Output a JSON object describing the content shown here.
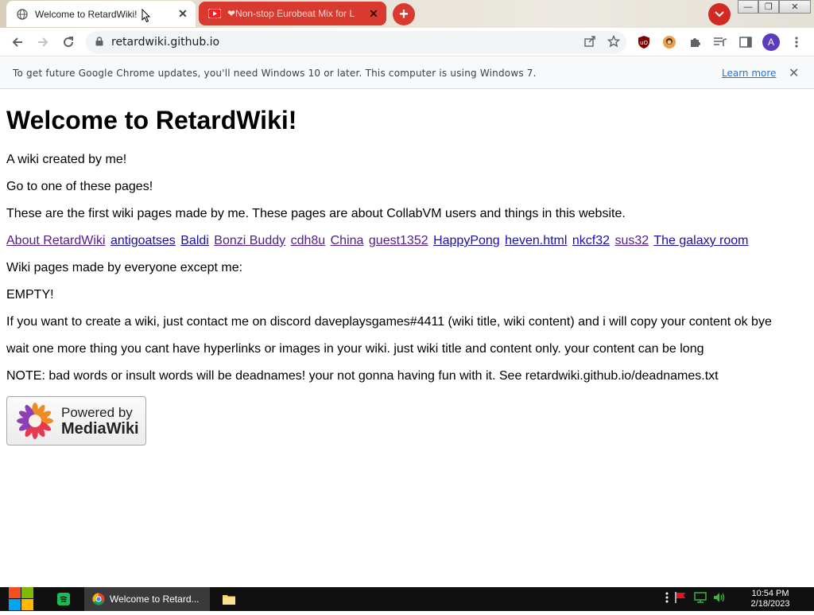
{
  "browser": {
    "tabs": [
      {
        "title": "Welcome to RetardWiki!",
        "active": true,
        "close": "✕"
      },
      {
        "title": "❤Non-stop Eurobeat Mix for L",
        "active": false,
        "close": "✕"
      }
    ],
    "new_tab": "+",
    "window_controls": {
      "minimize": "—",
      "restore": "❐",
      "close": "✕"
    },
    "url": "retardwiki.github.io",
    "avatar_letter": "A"
  },
  "infobar": {
    "message": "To get future Google Chrome updates, you'll need Windows 10 or later. This computer is using Windows 7.",
    "link": "Learn more",
    "close": "✕"
  },
  "page": {
    "heading": "Welcome to RetardWiki!",
    "paragraphs": [
      "A wiki created by me!",
      "Go to one of these pages!",
      "These are the first wiki pages made by me. These pages are about CollabVM users and things in this website."
    ],
    "links": [
      {
        "label": "About RetardWiki",
        "visited": true
      },
      {
        "label": "antigoatses",
        "visited": false
      },
      {
        "label": "Baldi",
        "visited": false
      },
      {
        "label": "Bonzi Buddy",
        "visited": true
      },
      {
        "label": "cdh8u",
        "visited": true
      },
      {
        "label": "China",
        "visited": true
      },
      {
        "label": "guest1352",
        "visited": true
      },
      {
        "label": "HappyPong",
        "visited": false
      },
      {
        "label": "heven.html",
        "visited": false
      },
      {
        "label": "nkcf32",
        "visited": false
      },
      {
        "label": "sus32",
        "visited": true
      },
      {
        "label": "The galaxy room",
        "visited": false
      }
    ],
    "paragraphs2": [
      "Wiki pages made by everyone except me:",
      "EMPTY!",
      "If you want to create a wiki, just contact me on discord daveplaysgames#4411 (wiki title, wiki content) and i will copy your content ok bye",
      "wait one more thing you cant have hyperlinks or images in your wiki. just wiki title and content only. your content can be long",
      "NOTE: bad words or insult words will be deadnames! your not gonna having fun with it. See retardwiki.github.io/deadnames.txt"
    ],
    "powered_by": {
      "line1": "Powered by",
      "line2": "MediaWiki"
    }
  },
  "taskbar": {
    "chrome_window": "Welcome to Retard...",
    "time": "10:54 PM",
    "date": "2/18/2023"
  },
  "colors": {
    "accent_red": "#d93a30",
    "link": "#1a0dab",
    "visited": "#551a8b",
    "avatar": "#5c3cba"
  }
}
